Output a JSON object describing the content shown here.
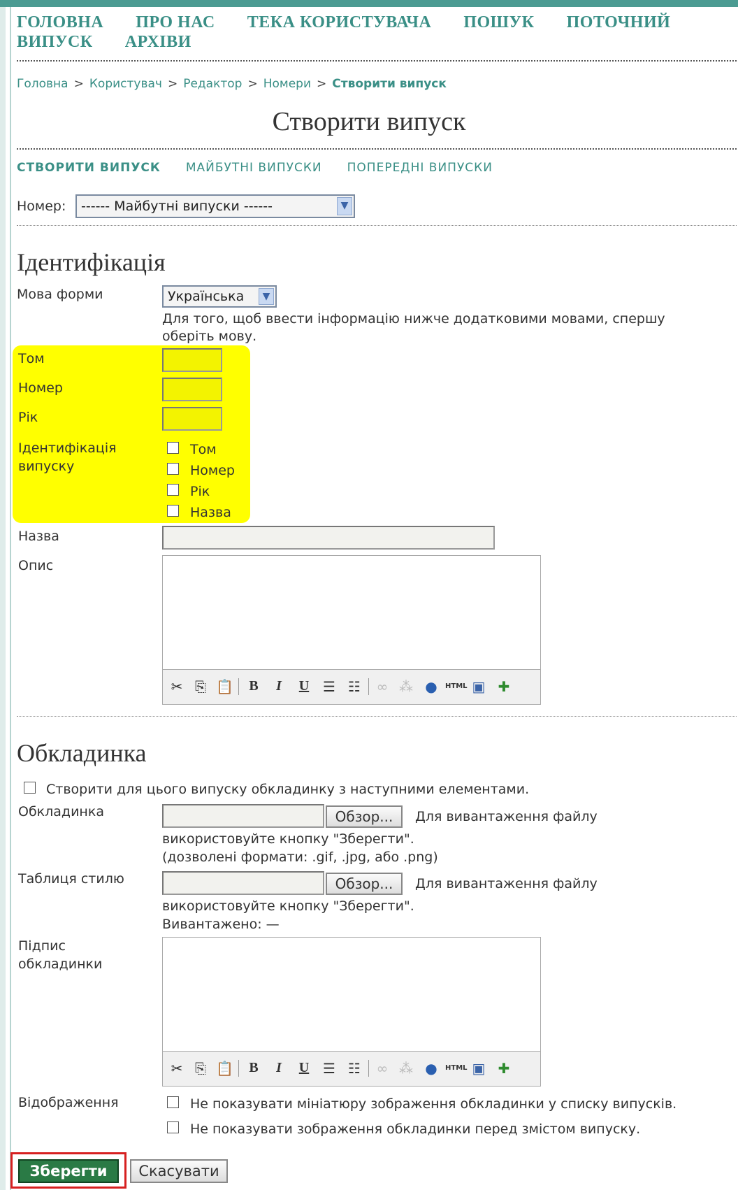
{
  "nav": {
    "row1": [
      "ГОЛОВНА",
      "ПРО НАС",
      "ТЕКА КОРИСТУВАЧА",
      "ПОШУК",
      "ПОТОЧНИЙ"
    ],
    "row2": [
      "ВИПУСК",
      "АРХІВИ"
    ]
  },
  "breadcrumb": [
    "Головна",
    "Користувач",
    "Редактор",
    "Номери",
    "Створити випуск"
  ],
  "breadcrumb_sep": ">",
  "page_title": "Створити випуск",
  "subtabs": [
    "СТВОРИТИ ВИПУСК",
    "МАЙБУТНІ ВИПУСКИ",
    "ПОПЕРЕДНІ ВИПУСКИ"
  ],
  "number_label": "Номер:",
  "number_select": "------ Майбутні випуски ------",
  "identification": {
    "heading": "Ідентифікація",
    "form_lang_label": "Мова форми",
    "form_lang_value": "Українська",
    "form_lang_hint": "Для того, щоб ввести інформацію нижче додатковими мовами, спершу оберіть мову.",
    "volume_label": "Том",
    "number_label": "Номер",
    "year_label": "Рік",
    "issue_id_label_1": "Ідентифікація",
    "issue_id_label_2": "випуску",
    "options": [
      "Том",
      "Номер",
      "Рік",
      "Назва"
    ],
    "title_label": "Назва",
    "desc_label": "Опис"
  },
  "cover": {
    "heading": "Обкладинка",
    "create_check": "Створити для цього випуску обкладинку з наступними елементами.",
    "cover_label": "Обкладинка",
    "browse": "Обзор...",
    "upload_hint_1": "Для вивантаження файлу",
    "upload_hint_2": "використовуйте кнопку \"Зберегти\".",
    "formats_hint": "(дозволені формати: .gif, .jpg, або .png)",
    "stylesheet_label": "Таблиця стилю",
    "uploaded": "Вивантажено: —",
    "caption_label_1": "Підпис",
    "caption_label_2": "обкладинки",
    "display_label": "Відображення",
    "display_opt1": "Не показувати мініатюру зображення обкладинки у списку випусків.",
    "display_opt2": "Не показувати зображення обкладинки перед змістом випуску."
  },
  "toolbar": [
    "cut-icon",
    "copy-icon",
    "paste-icon",
    "bold-icon",
    "italic-icon",
    "underline-icon",
    "bullet-list-icon",
    "numbered-list-icon",
    "link-icon",
    "unlink-icon",
    "help-icon",
    "html-icon",
    "fullscreen-icon",
    "image-icon"
  ],
  "toolbar_text": {
    "bold": "B",
    "italic": "I",
    "underline": "U",
    "html": "HTML"
  },
  "actions": {
    "save": "Зберегти",
    "cancel": "Скасувати"
  },
  "colors": {
    "accent": "#3a8f86",
    "highlight": "#ffff00",
    "save_bg": "#2a7a45",
    "save_outline": "#d62020"
  }
}
